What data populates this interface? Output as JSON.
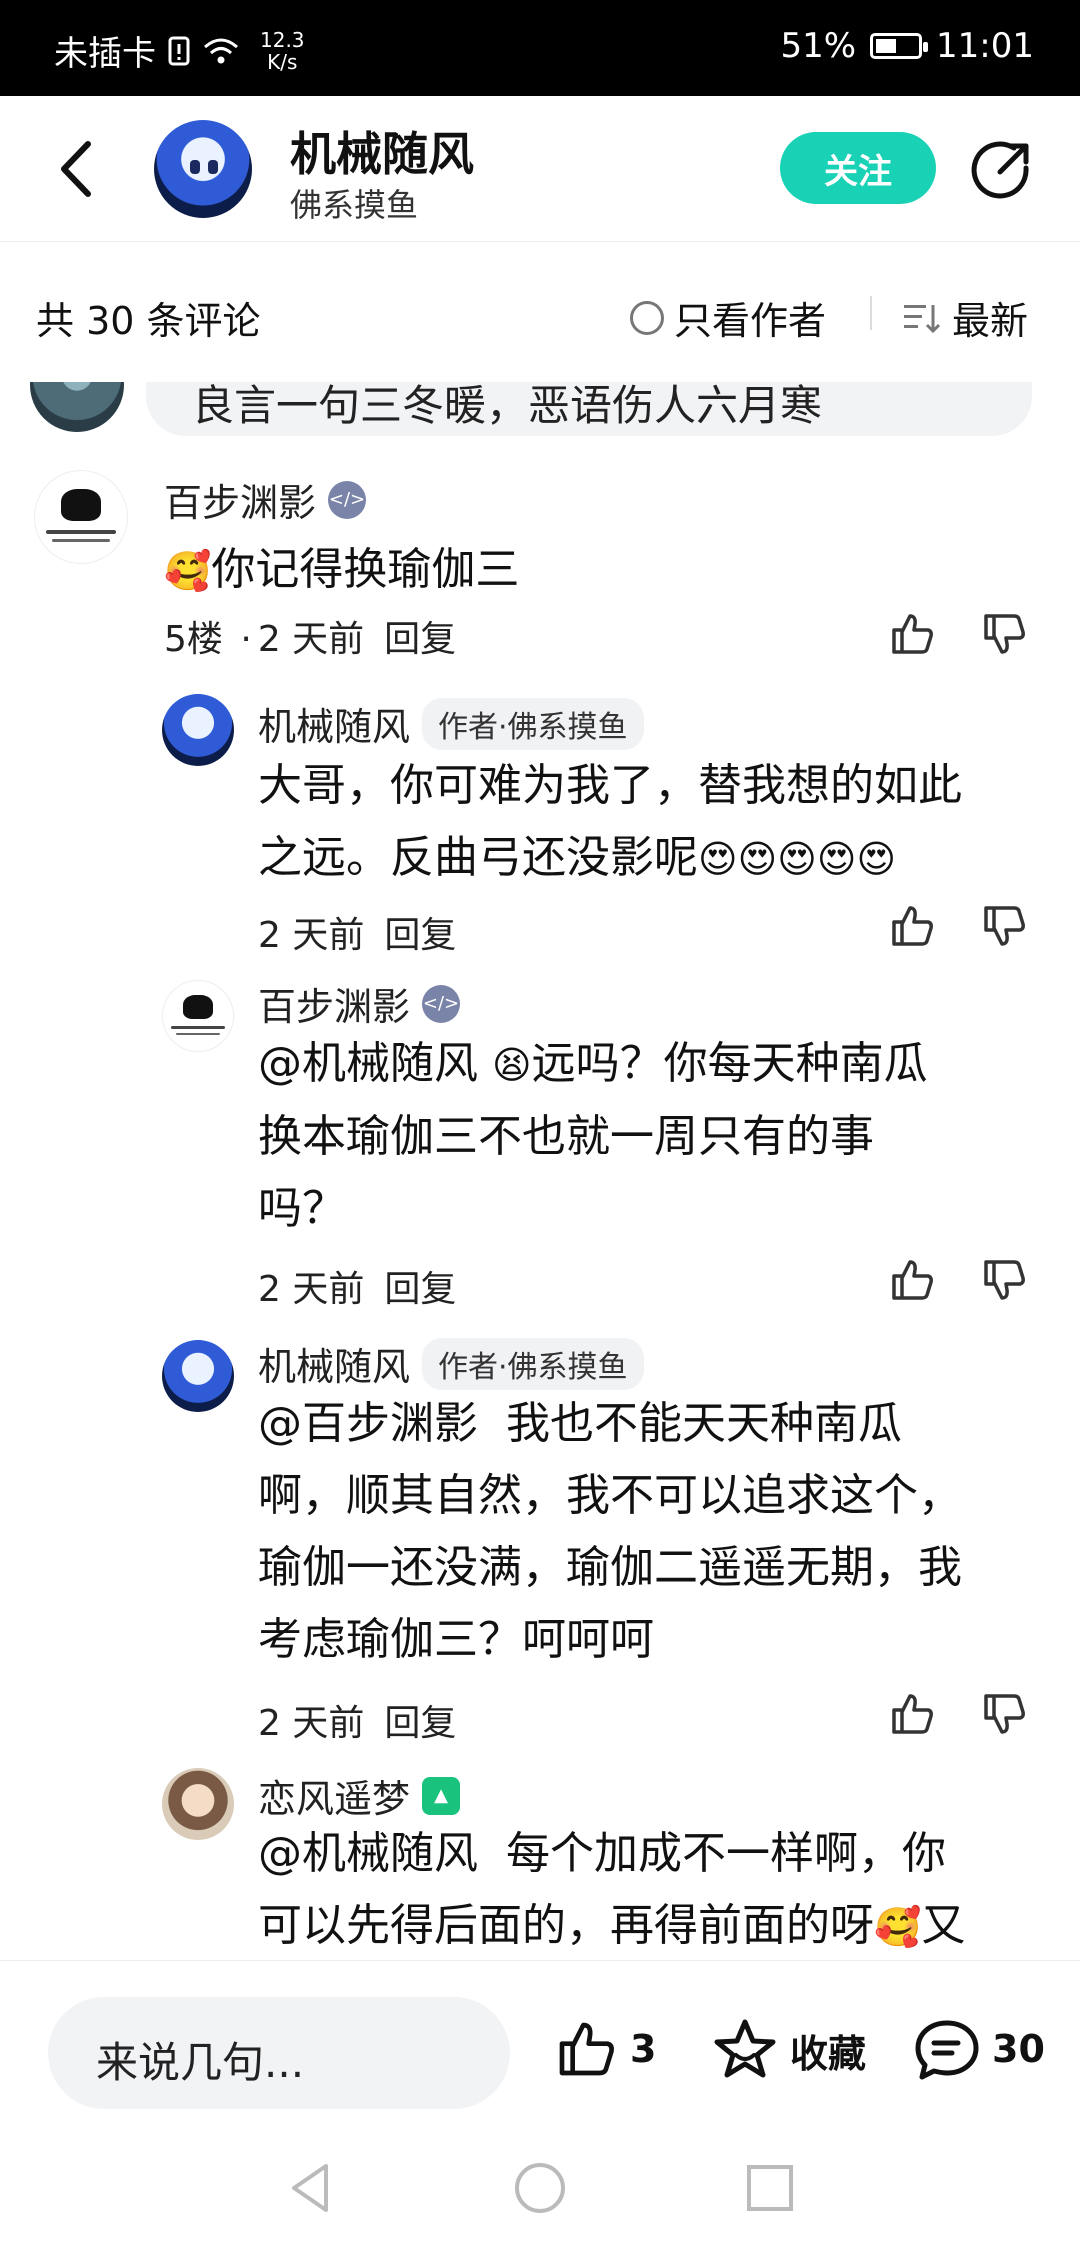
{
  "status_bar": {
    "carrier": "未插卡",
    "speed_value": "12.3",
    "speed_unit": "K/s",
    "battery": "51%",
    "battery_level": 0.51,
    "time": "11:01"
  },
  "header": {
    "author_name": "机械随风",
    "author_subtitle": "佛系摸鱼",
    "follow_label": "关注"
  },
  "comments_bar": {
    "count_label": "共 30 条评论",
    "only_author_label": "只看作者",
    "sort_label": "最新"
  },
  "previous_comment": {
    "text": "良言一句三冬暖，恶语伤人六月寒"
  },
  "comments": [
    {
      "user": "百步渊影",
      "text": "你记得换瑜伽三",
      "floor": "5楼",
      "dot": "·",
      "time": "2 天前",
      "reply_label": "回复"
    },
    {
      "user": "机械随风",
      "badge": "作者·佛系摸鱼",
      "text_line1": "大哥，你可难为我了，替我想的如此",
      "text_line2": "之远。反曲弓还没影呢",
      "time": "2 天前",
      "reply_label": "回复"
    },
    {
      "user": "百步渊影",
      "mention": "@机械随风",
      "text_line1": "远吗？你每天种南瓜",
      "text_line2": "换本瑜伽三不也就一周只有的事",
      "text_line3": "吗？",
      "time": "2 天前",
      "reply_label": "回复"
    },
    {
      "user": "机械随风",
      "badge": "作者·佛系摸鱼",
      "mention": "@百步渊影",
      "text_line1": "我也不能天天种南瓜",
      "text_line2": "啊，顺其自然，我不可以追求这个，",
      "text_line3": "瑜伽一还没满，瑜伽二遥遥无期，我",
      "text_line4": "考虑瑜伽三？呵呵呵",
      "time": "2 天前",
      "reply_label": "回复"
    },
    {
      "user": "恋风遥梦",
      "mention": "@机械随风",
      "text_line1": "每个加成不一样啊，你",
      "text_line2": "可以先得后面的，再得前面的呀",
      "text_line2_tail": "又"
    }
  ],
  "bottom_bar": {
    "input_placeholder": "来说几句...",
    "like_count": "3",
    "favorite_label": "收藏",
    "comment_count": "30"
  },
  "colors": {
    "accent": "#19d1b5",
    "status_bg": "#000000"
  },
  "icons": {
    "back": "back-arrow-icon",
    "share": "share-icon",
    "like": "thumbs-up-icon",
    "dislike": "thumbs-down-icon",
    "favorite": "star-icon",
    "comment": "comment-bubble-icon"
  }
}
